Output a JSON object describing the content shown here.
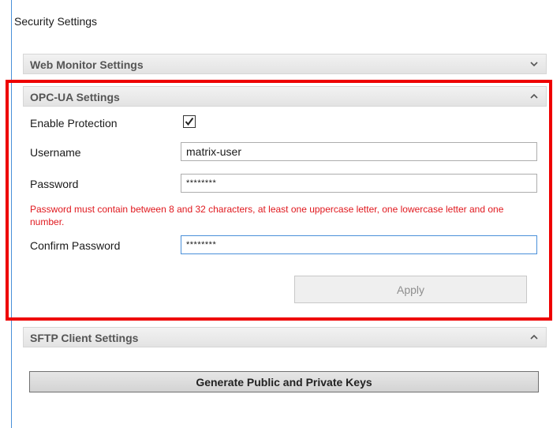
{
  "page": {
    "title": "Security Settings"
  },
  "sections": {
    "web_monitor": {
      "title": "Web Monitor Settings",
      "expanded": false,
      "chevron_icon": "chevron-down-icon"
    },
    "opc_ua": {
      "title": "OPC-UA Settings",
      "expanded": true,
      "chevron_icon": "chevron-up-icon",
      "enable_protection": {
        "label": "Enable Protection",
        "checked": true
      },
      "username": {
        "label": "Username",
        "value": "matrix-user"
      },
      "password": {
        "label": "Password",
        "value": "********"
      },
      "error_message": "Password must contain between 8 and 32 characters, at least one uppercase letter, one lowercase letter and one number.",
      "confirm_password": {
        "label": "Confirm Password",
        "value": "********"
      },
      "apply_label": "Apply"
    },
    "sftp_client": {
      "title": "SFTP Client Settings",
      "expanded": true,
      "chevron_icon": "chevron-up-icon",
      "generate_keys_label": "Generate Public and Private Keys"
    }
  },
  "colors": {
    "highlight": "#ee0000",
    "error_text": "#e0181e",
    "focus_border": "#4a90d9"
  }
}
